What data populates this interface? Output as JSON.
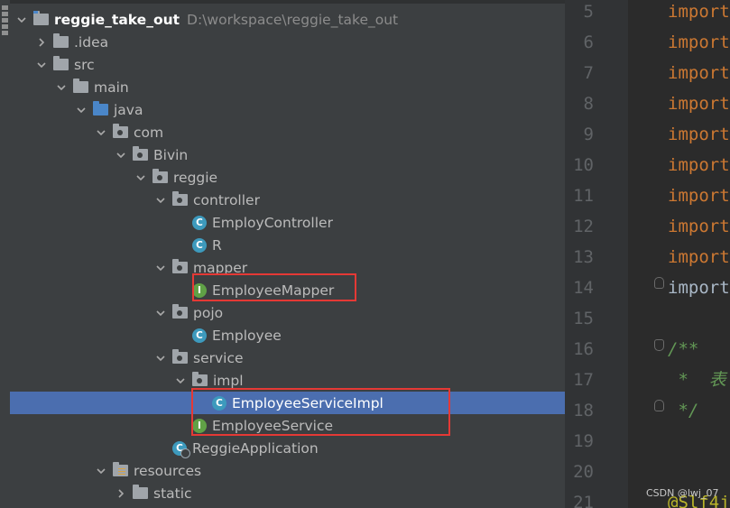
{
  "project_tree": {
    "root": {
      "name": "reggie_take_out",
      "path": "D:\\workspace\\reggie_take_out"
    },
    "items": [
      {
        "label": ".idea",
        "kind": "folder",
        "expanded": false
      },
      {
        "label": "src",
        "kind": "folder",
        "expanded": true
      },
      {
        "label": "main",
        "kind": "folder",
        "expanded": true
      },
      {
        "label": "java",
        "kind": "source-root",
        "expanded": true
      },
      {
        "label": "com",
        "kind": "package",
        "expanded": true
      },
      {
        "label": "Bivin",
        "kind": "package",
        "expanded": true
      },
      {
        "label": "reggie",
        "kind": "package",
        "expanded": true
      },
      {
        "label": "controller",
        "kind": "package",
        "expanded": true
      },
      {
        "label": "EmployController",
        "kind": "class",
        "badge": "C"
      },
      {
        "label": "R",
        "kind": "class",
        "badge": "C"
      },
      {
        "label": "mapper",
        "kind": "package",
        "expanded": true
      },
      {
        "label": "EmployeeMapper",
        "kind": "interface",
        "badge": "I",
        "highlighted": true
      },
      {
        "label": "pojo",
        "kind": "package",
        "expanded": true
      },
      {
        "label": "Employee",
        "kind": "class",
        "badge": "C"
      },
      {
        "label": "service",
        "kind": "package",
        "expanded": true
      },
      {
        "label": "impl",
        "kind": "package",
        "expanded": true
      },
      {
        "label": "EmployeeServiceImpl",
        "kind": "class",
        "badge": "C",
        "selected": true,
        "highlighted": true
      },
      {
        "label": "EmployeeService",
        "kind": "interface",
        "badge": "I",
        "highlighted": true
      },
      {
        "label": "ReggieApplication",
        "kind": "spring-app",
        "badge": "C"
      },
      {
        "label": "resources",
        "kind": "resources-root",
        "expanded": true
      },
      {
        "label": "static",
        "kind": "folder",
        "expanded": false
      }
    ]
  },
  "editor": {
    "lines": [
      {
        "num": "5",
        "text": "import",
        "style": "keyword"
      },
      {
        "num": "6",
        "text": "import",
        "style": "keyword"
      },
      {
        "num": "7",
        "text": "import",
        "style": "keyword"
      },
      {
        "num": "8",
        "text": "import",
        "style": "keyword"
      },
      {
        "num": "9",
        "text": "import",
        "style": "keyword"
      },
      {
        "num": "10",
        "text": "import",
        "style": "keyword"
      },
      {
        "num": "11",
        "text": "import",
        "style": "keyword"
      },
      {
        "num": "12",
        "text": "import",
        "style": "keyword"
      },
      {
        "num": "13",
        "text": "import",
        "style": "keyword"
      },
      {
        "num": "14",
        "text": "import",
        "style": "plain"
      },
      {
        "num": "15",
        "text": "",
        "style": "plain"
      },
      {
        "num": "16",
        "text": "/**",
        "style": "comment"
      },
      {
        "num": "17",
        "text": " *  表",
        "style": "comment"
      },
      {
        "num": "18",
        "text": " */",
        "style": "comment"
      },
      {
        "num": "19",
        "text": "",
        "style": "plain"
      },
      {
        "num": "20",
        "text": "",
        "style": "plain"
      },
      {
        "num": "21",
        "text": "@Slf4j",
        "style": "annotation"
      }
    ]
  },
  "watermark": "CSDN @lwj_07",
  "colors": {
    "selection": "#4b6eaf",
    "highlight_box": "#e53935",
    "keyword": "#cc7832",
    "comment": "#629755",
    "annotation": "#bbb529"
  }
}
